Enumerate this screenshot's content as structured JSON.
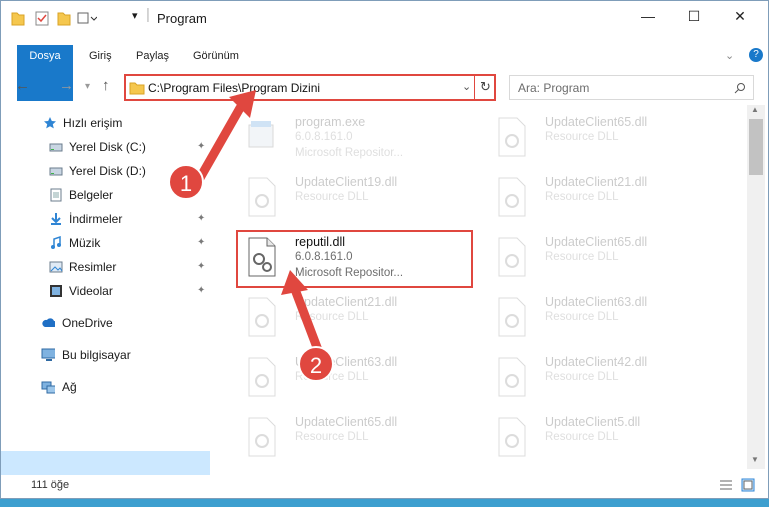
{
  "window": {
    "title": "Program"
  },
  "controls": {
    "minimize": "—",
    "maximize": "☐",
    "close": "✕"
  },
  "ribbon": {
    "tabs": [
      "Dosya",
      "Giriş",
      "Paylaş",
      "Görünüm"
    ],
    "help": "?"
  },
  "nav": {
    "address": "C:\\Program Files\\Program Dizini",
    "search_placeholder": "Ara: Program"
  },
  "sidebar": {
    "items": [
      {
        "label": "Hızlı erişim",
        "icon": "star-icon"
      },
      {
        "label": "Yerel Disk (C:)",
        "icon": "drive-icon"
      },
      {
        "label": "Yerel Disk (D:)",
        "icon": "drive-icon"
      },
      {
        "label": "Belgeler",
        "icon": "documents-icon"
      },
      {
        "label": "İndirmeler",
        "icon": "downloads-icon"
      },
      {
        "label": "Müzik",
        "icon": "music-icon"
      },
      {
        "label": "Resimler",
        "icon": "pictures-icon"
      },
      {
        "label": "Videolar",
        "icon": "videos-icon"
      },
      {
        "label": "OneDrive",
        "icon": "cloud-icon"
      },
      {
        "label": "Bu bilgisayar",
        "icon": "computer-icon"
      },
      {
        "label": "Ağ",
        "icon": "network-icon"
      }
    ]
  },
  "files": [
    {
      "name": "program.exe",
      "line2": "6.0.8.161.0",
      "line3": "Microsoft Repositor..."
    },
    {
      "name": "UpdateClient65.dll",
      "line2": "Resource DLL"
    },
    {
      "name": "UpdateClient19.dll",
      "line2": "Resource DLL"
    },
    {
      "name": "UpdateClient21.dll",
      "line2": "Resource DLL"
    },
    {
      "name": "reputil.dll",
      "line2": "6.0.8.161.0",
      "line3": "Microsoft Repositor..."
    },
    {
      "name": "UpdateClient65.dll",
      "line2": "Resource DLL"
    },
    {
      "name": "UpdateClient21.dll",
      "line2": "Resource DLL"
    },
    {
      "name": "UpdateClient63.dll",
      "line2": "Resource DLL"
    },
    {
      "name": "UpdateClient63.dll",
      "line2": "Resource DLL"
    },
    {
      "name": "UpdateClient42.dll",
      "line2": "Resource DLL"
    },
    {
      "name": "UpdateClient65.dll",
      "line2": "Resource DLL"
    },
    {
      "name": "UpdateClient5.dll",
      "line2": "Resource DLL"
    }
  ],
  "status": {
    "count": "111 öğe"
  },
  "callouts": [
    "1",
    "2"
  ],
  "colors": {
    "accent": "#1979ca",
    "highlight": "#e0473f",
    "selection": "#cce8ff"
  }
}
